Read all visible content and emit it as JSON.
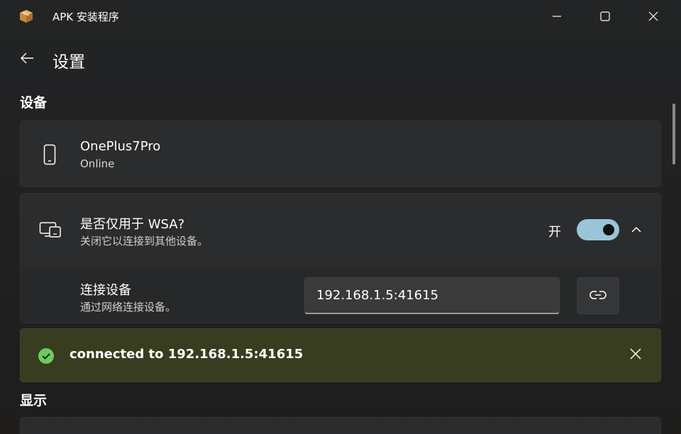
{
  "window": {
    "title": "APK 安装程序",
    "app_icon": "package-box-icon",
    "controls": [
      "minimize-icon",
      "maximize-icon",
      "close-icon"
    ]
  },
  "header": {
    "title": "设置",
    "back_icon": "arrow-left-icon"
  },
  "sections": {
    "device_title": "设备",
    "display_title": "显示"
  },
  "device_card": {
    "icon": "phone-icon",
    "name": "OnePlus7Pro",
    "status": "Online"
  },
  "wsa_card": {
    "icon": "devices-icon",
    "title": "是否仅用于 WSA?",
    "description": "关闭它以连接到其他设备。",
    "toggle_label": "开",
    "toggle_on": true,
    "chevron_icon": "chevron-up-icon"
  },
  "connect_card": {
    "title": "连接设备",
    "description": "通过网络连接设备。",
    "input_value": "192.168.1.5:41615",
    "button_icon": "link-icon"
  },
  "info_bar": {
    "icon": "checkmark-circle-icon",
    "message": "connected to 192.168.1.5:41615",
    "close_icon": "close-icon"
  },
  "colors": {
    "accent": "#98c6d8",
    "success": "#6ccb5f",
    "info_bar_bg": "#393d1f",
    "card_bg": "#2b2c2d"
  }
}
